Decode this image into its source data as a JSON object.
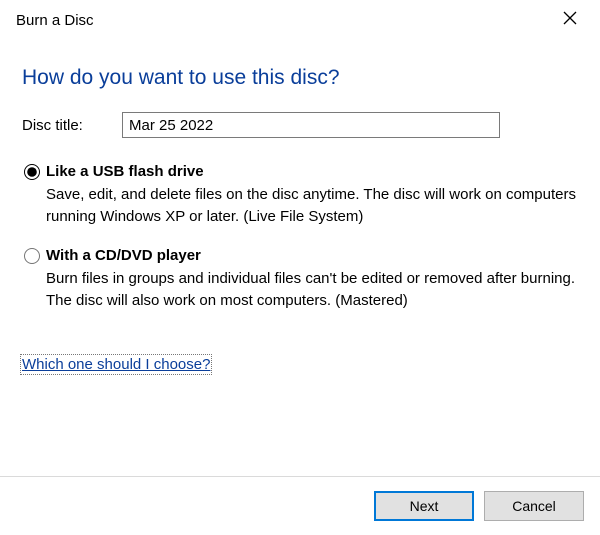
{
  "titlebar": {
    "title": "Burn a Disc"
  },
  "heading": "How do you want to use this disc?",
  "discTitle": {
    "label": "Disc title:",
    "value": "Mar 25 2022"
  },
  "options": [
    {
      "title": "Like a USB flash drive",
      "desc": "Save, edit, and delete files on the disc anytime. The disc will work on computers running Windows XP or later. (Live File System)",
      "selected": true
    },
    {
      "title": "With a CD/DVD player",
      "desc": "Burn files in groups and individual files can't be edited or removed after burning. The disc will also work on most computers. (Mastered)",
      "selected": false
    }
  ],
  "helpLink": "Which one should I choose?",
  "footer": {
    "next": "Next",
    "cancel": "Cancel"
  }
}
